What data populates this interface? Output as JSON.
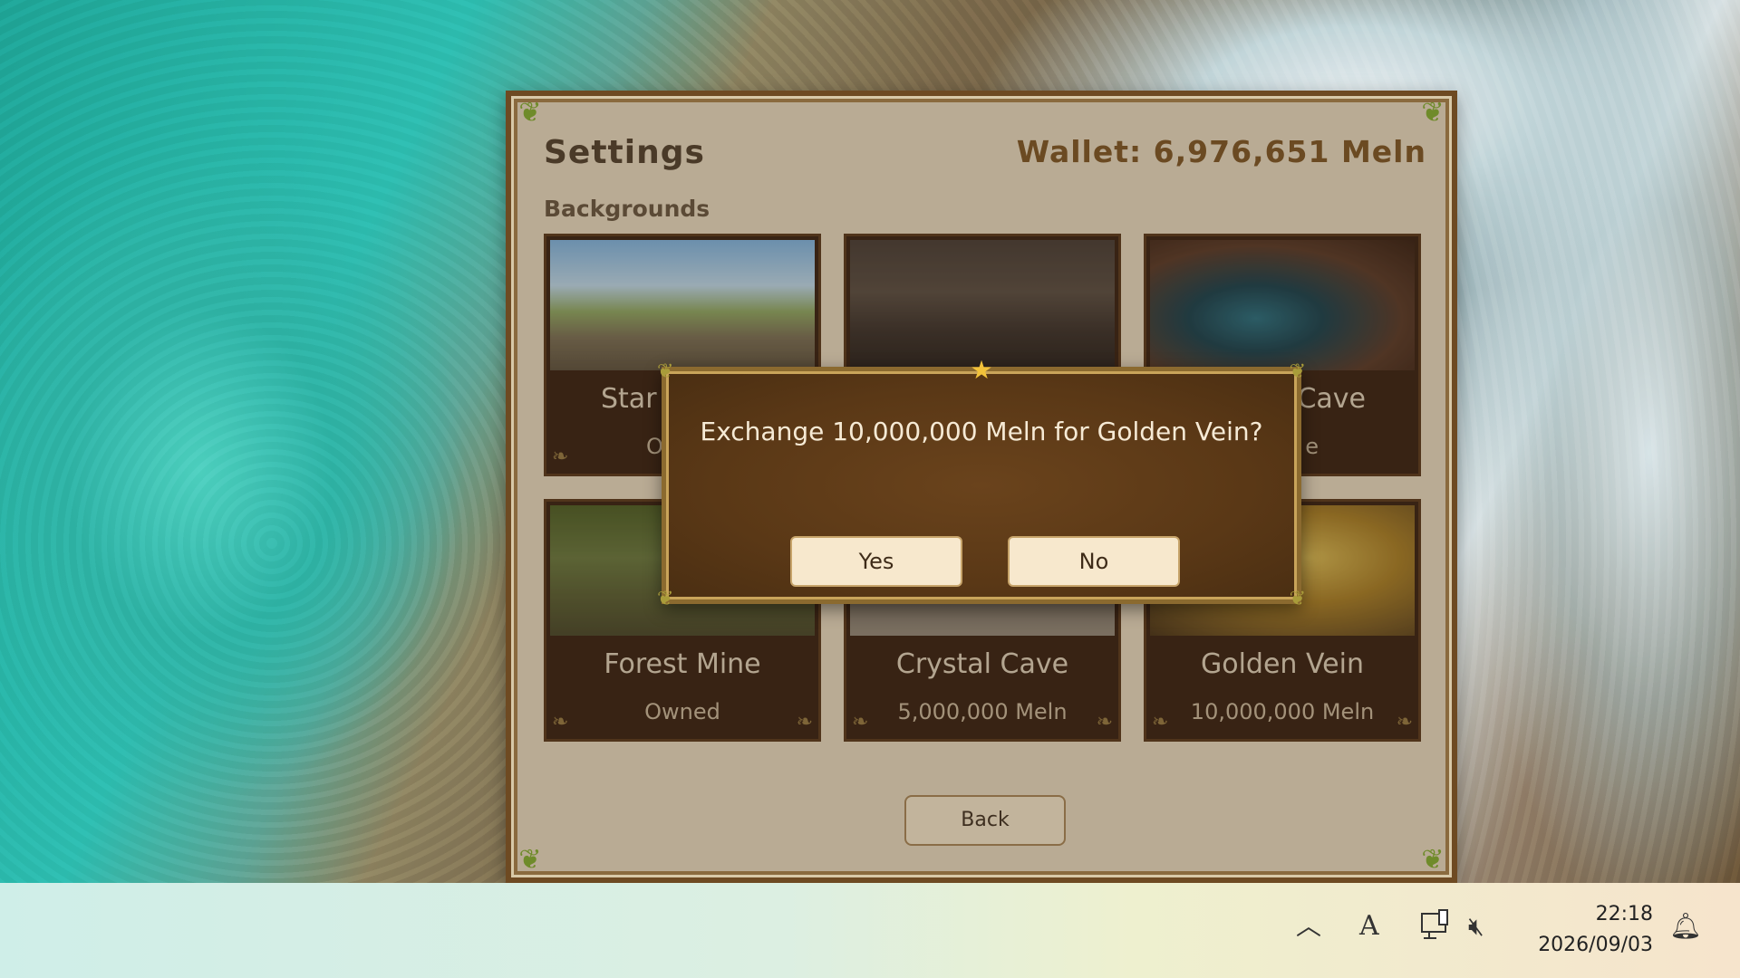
{
  "game": {
    "title": "Settings",
    "wallet": "Wallet: 6,976,651 Meln",
    "section": "Backgrounds",
    "back_label": "Back",
    "backgrounds": [
      {
        "name": "Star",
        "status": "O"
      },
      {
        "name": "",
        "status": ""
      },
      {
        "name": "Cave",
        "status": "e"
      },
      {
        "name": "Forest Mine",
        "status": "Owned"
      },
      {
        "name": "Crystal Cave",
        "status": "5,000,000 Meln"
      },
      {
        "name": "Golden Vein",
        "status": "10,000,000 Meln"
      }
    ]
  },
  "dialog": {
    "message": "Exchange 10,000,000 Meln for Golden Vein?",
    "yes_label": "Yes",
    "no_label": "No"
  },
  "taskbar": {
    "time": "22:18",
    "date": "2026/09/03",
    "tray_icons": [
      "chevron-up-icon",
      "ime-a-icon",
      "network-icon",
      "speaker-muted-icon",
      "notification-icon"
    ],
    "ime_label": "A"
  },
  "colors": {
    "panel": "#b9ab94",
    "card": "#4a2f1a",
    "dialog": "#5a3816",
    "button": "#f7e8cd"
  }
}
